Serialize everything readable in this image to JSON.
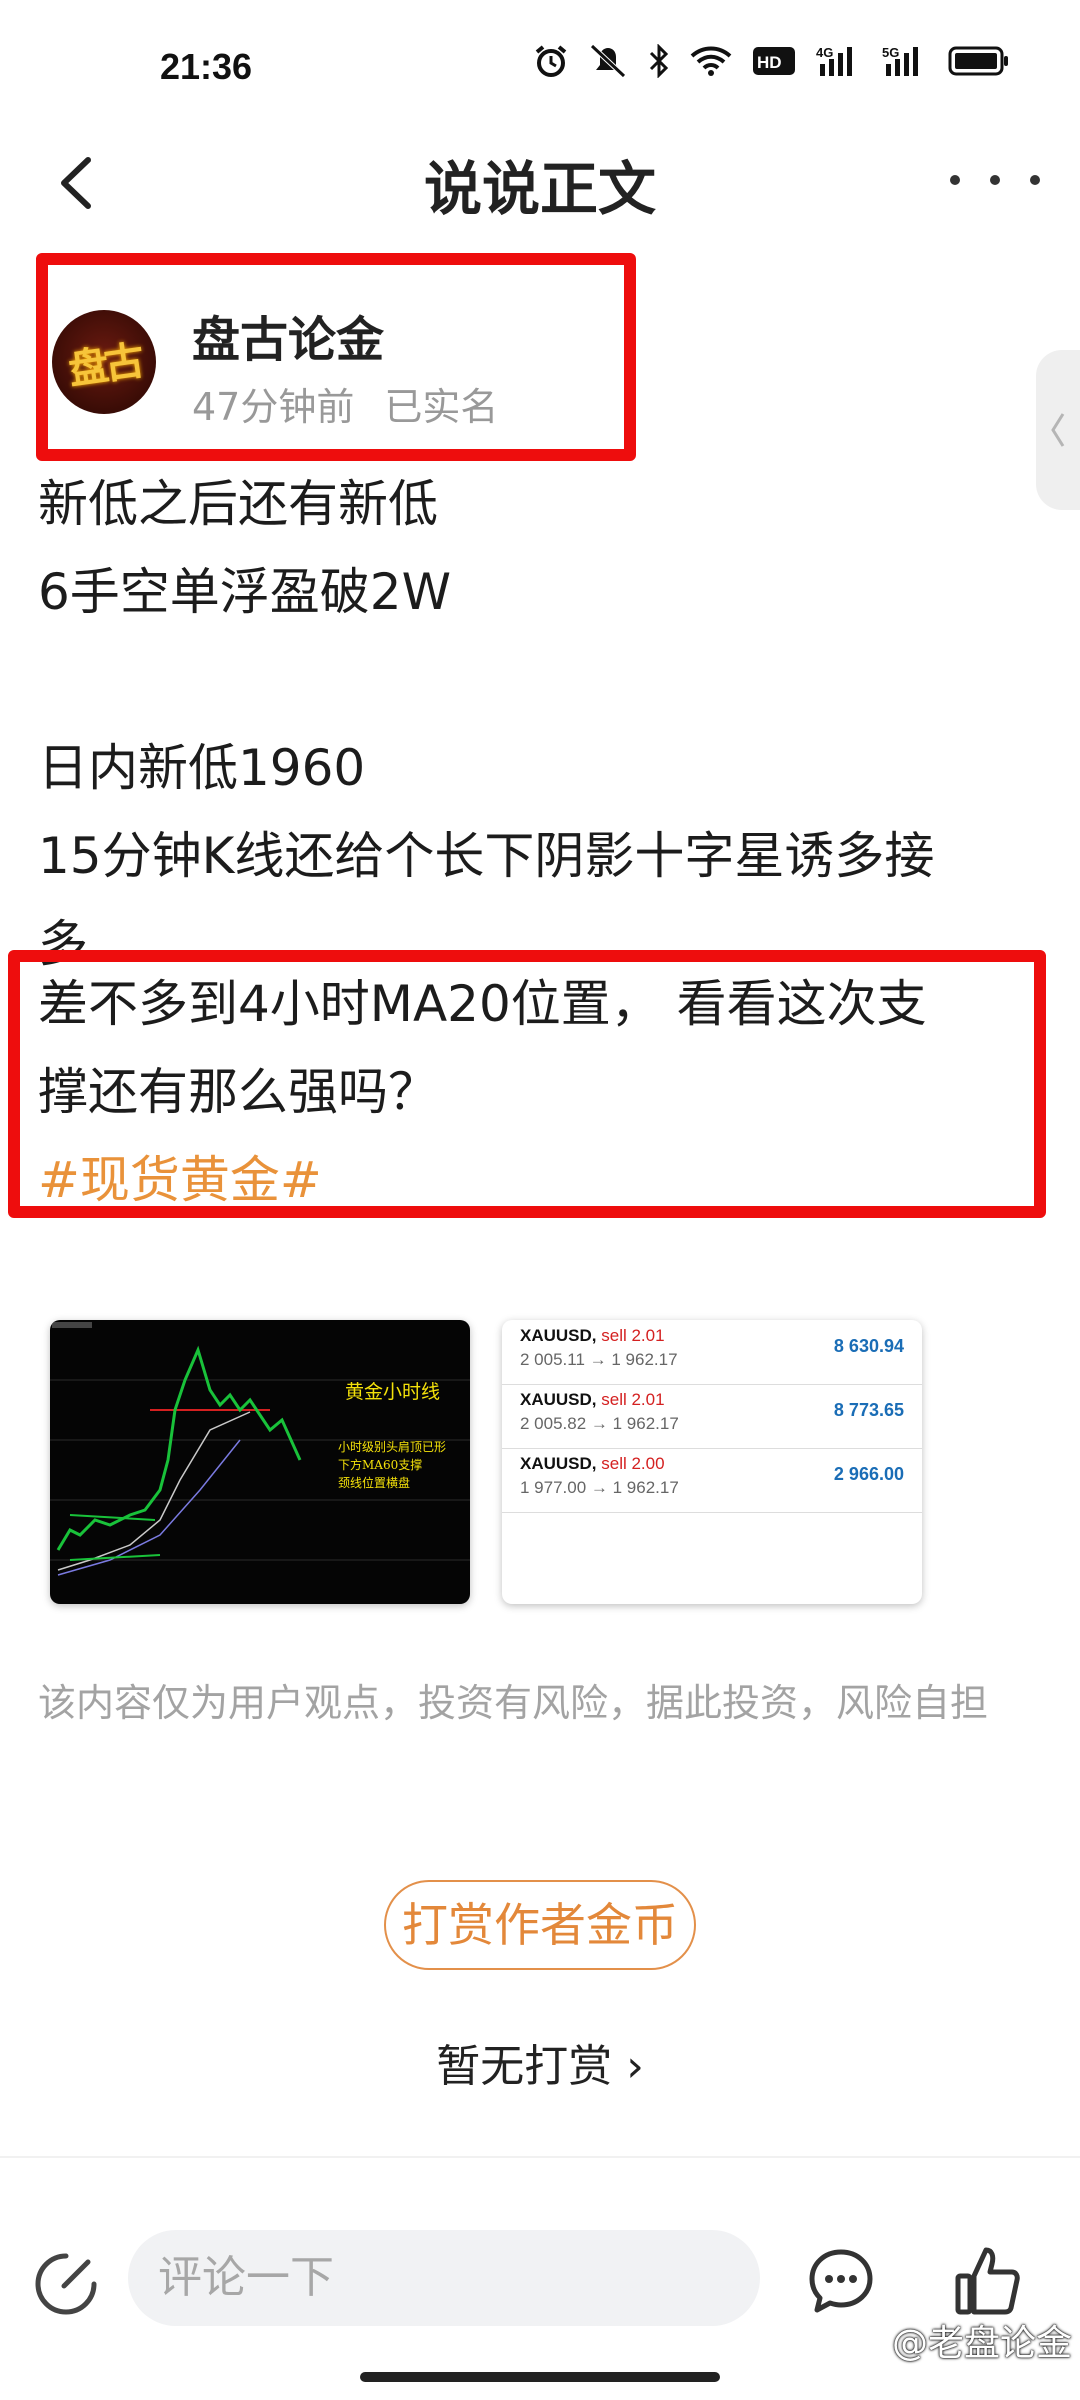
{
  "status_bar": {
    "time": "21:36",
    "icons": [
      "alarm-icon",
      "mute-icon",
      "bluetooth-icon",
      "wifi-icon",
      "hd-icon",
      "signal-4g-icon",
      "signal-5g-icon",
      "battery-icon"
    ],
    "hd_label": "HD",
    "net1": "4G",
    "net2": "5G"
  },
  "nav": {
    "title": "说说正文"
  },
  "author": {
    "name": "盘古论金",
    "avatar_text": "盘古",
    "time_ago": "47分钟前",
    "verified": "已实名"
  },
  "post": {
    "block1": "新低之后还有新低\n6手空单浮盈破2W\n\n日内新低1960\n15分钟K线还给个长下阴影十字星诱多接\n多",
    "block2": "差不多到4小时MA20位置， 看看这次支\n撑还有那么强吗？",
    "hashtag": "#现货黄金#"
  },
  "images": {
    "chart": {
      "title": "黄金小时线",
      "notes": [
        "小时级别头肩顶已形",
        "下方MA60支撑",
        "颈线位置横盘"
      ]
    },
    "trades": [
      {
        "symbol": "XAUUSD,",
        "side": "sell 2.01",
        "prices": "2 005.11 → 1 962.17",
        "profit": "8 630.94"
      },
      {
        "symbol": "XAUUSD,",
        "side": "sell 2.01",
        "prices": "2 005.82 → 1 962.17",
        "profit": "8 773.65"
      },
      {
        "symbol": "XAUUSD,",
        "side": "sell 2.00",
        "prices": "1 977.00 → 1 962.17",
        "profit": "2 966.00"
      }
    ]
  },
  "disclaimer": "该内容仅为用户观点，投资有风险，据此投资，风险自担",
  "reward": {
    "button_label": "打赏作者金币",
    "status": "暂无打赏 ›"
  },
  "bottom_bar": {
    "comment_placeholder": "评论一下",
    "watermark": "@老盘论金"
  },
  "colors": {
    "highlight_border": "#ee0d0d",
    "hashtag": "#e9923a",
    "reward": "#e3883a",
    "profit": "#1a6db6",
    "sell": "#d42020"
  }
}
